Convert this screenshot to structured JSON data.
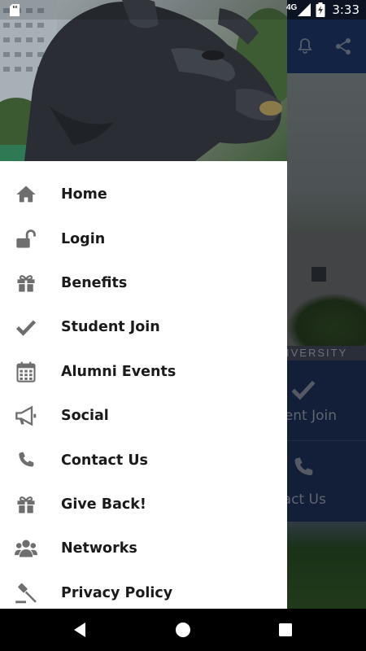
{
  "status_bar": {
    "network": "4G",
    "time": "3:33"
  },
  "background": {
    "sign_text": "IVERSITY",
    "tiles": [
      {
        "label": "dent Join",
        "icon": "check-icon"
      },
      {
        "label": "tact Us",
        "icon": "phone-icon"
      }
    ]
  },
  "drawer": {
    "header_image": "panther-statue",
    "items": [
      {
        "label": "Home",
        "icon": "home-icon"
      },
      {
        "label": "Login",
        "icon": "unlock-icon"
      },
      {
        "label": "Benefits",
        "icon": "gift-icon"
      },
      {
        "label": "Student Join",
        "icon": "check-icon"
      },
      {
        "label": "Alumni Events",
        "icon": "calendar-icon"
      },
      {
        "label": "Social",
        "icon": "megaphone-icon"
      },
      {
        "label": "Contact Us",
        "icon": "phone-icon"
      },
      {
        "label": "Give Back!",
        "icon": "gift-icon"
      },
      {
        "label": "Networks",
        "icon": "users-icon"
      },
      {
        "label": "Privacy Policy",
        "icon": "gavel-icon"
      }
    ]
  },
  "colors": {
    "toolbar": "#24407a",
    "menu_text": "#1a1a1a",
    "menu_icon": "#6e6e6e"
  }
}
